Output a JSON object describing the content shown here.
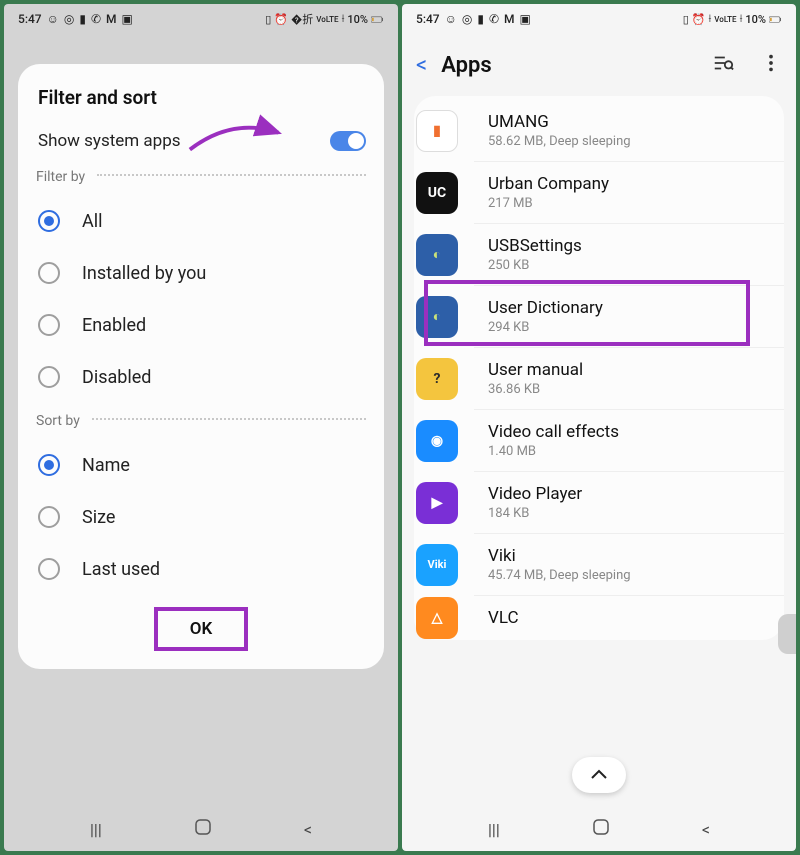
{
  "status": {
    "time": "5:47",
    "battery_pct": "10%"
  },
  "left": {
    "title": "Filter and sort",
    "show_system": "Show system apps",
    "filter_by": "Filter by",
    "sort_by": "Sort by",
    "options_filter": [
      {
        "label": "All",
        "checked": true
      },
      {
        "label": "Installed by you",
        "checked": false
      },
      {
        "label": "Enabled",
        "checked": false
      },
      {
        "label": "Disabled",
        "checked": false
      }
    ],
    "options_sort": [
      {
        "label": "Name",
        "checked": true
      },
      {
        "label": "Size",
        "checked": false
      },
      {
        "label": "Last used",
        "checked": false
      }
    ],
    "ok": "OK"
  },
  "right": {
    "title": "Apps",
    "items": [
      {
        "name": "UMANG",
        "sub": "58.62 MB, Deep sleeping",
        "bg": "#ffffff",
        "fg": "#f07030",
        "txt": "▮"
      },
      {
        "name": "Urban Company",
        "sub": "217 MB",
        "bg": "#111111",
        "fg": "#ffffff",
        "txt": "UC"
      },
      {
        "name": "USBSettings",
        "sub": "250 KB",
        "bg": "#2d5fa8",
        "fg": "#c9e27a",
        "txt": "◐"
      },
      {
        "name": "User Dictionary",
        "sub": "294 KB",
        "bg": "#2d5fa8",
        "fg": "#c9e27a",
        "txt": "◐"
      },
      {
        "name": "User manual",
        "sub": "36.86 KB",
        "bg": "#f4c53e",
        "fg": "#2b2b2b",
        "txt": "?"
      },
      {
        "name": "Video call effects",
        "sub": "1.40 MB",
        "bg": "#1a8cff",
        "fg": "#ffffff",
        "txt": "◉"
      },
      {
        "name": "Video Player",
        "sub": "184 KB",
        "bg": "#7a2fd6",
        "fg": "#ffffff",
        "txt": "▶"
      },
      {
        "name": "Viki",
        "sub": "45.74 MB, Deep sleeping",
        "bg": "#1aa2ff",
        "fg": "#ffffff",
        "txt": "Viki"
      },
      {
        "name": "VLC",
        "sub": "",
        "bg": "#ff8a1f",
        "fg": "#ffffff",
        "txt": "△"
      }
    ]
  }
}
